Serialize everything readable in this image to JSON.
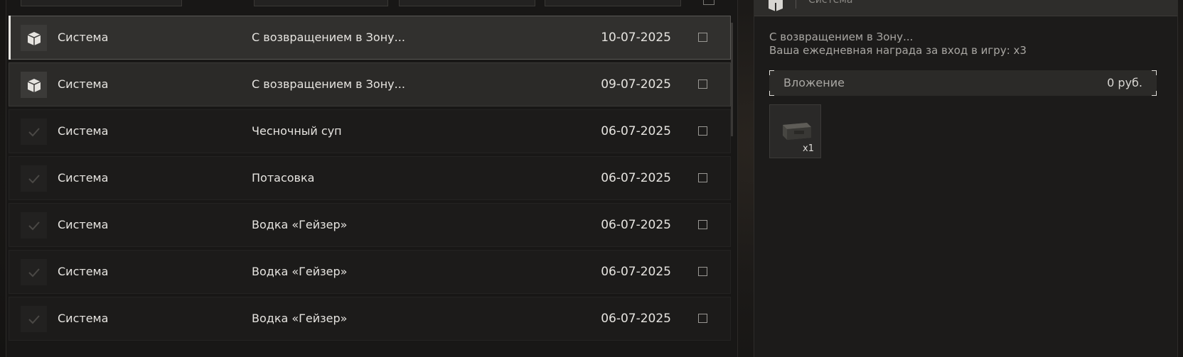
{
  "list": {
    "rows": [
      {
        "sender": "Система",
        "subject": "С возвращением в Зону...",
        "date": "10-07-2025",
        "state": "unread-selected"
      },
      {
        "sender": "Система",
        "subject": "С возвращением в Зону...",
        "date": "09-07-2025",
        "state": "unread"
      },
      {
        "sender": "Система",
        "subject": "Чесночный суп",
        "date": "06-07-2025",
        "state": "read"
      },
      {
        "sender": "Система",
        "subject": "Потасовка",
        "date": "06-07-2025",
        "state": "read"
      },
      {
        "sender": "Система",
        "subject": "Водка «Гейзер»",
        "date": "06-07-2025",
        "state": "read"
      },
      {
        "sender": "Система",
        "subject": "Водка «Гейзер»",
        "date": "06-07-2025",
        "state": "read"
      },
      {
        "sender": "Система",
        "subject": "Водка «Гейзер»",
        "date": "06-07-2025",
        "state": "read"
      }
    ],
    "icons": {
      "unread": "box-icon",
      "read": "check-icon"
    }
  },
  "detail": {
    "sender_label": "Система",
    "message_line_1": "С возвращением в Зону...",
    "message_line_2": "Ваша ежедневная награда за вход в игру: x3",
    "attachment_label": "Вложение",
    "attachment_amount": "0  руб.",
    "item": {
      "icon": "ammo-box-icon",
      "quantity": "x1"
    }
  },
  "colors": {
    "accent": "#e8e6e2",
    "panel": "#1c1b1a",
    "unread_row": "#2b2a28"
  }
}
